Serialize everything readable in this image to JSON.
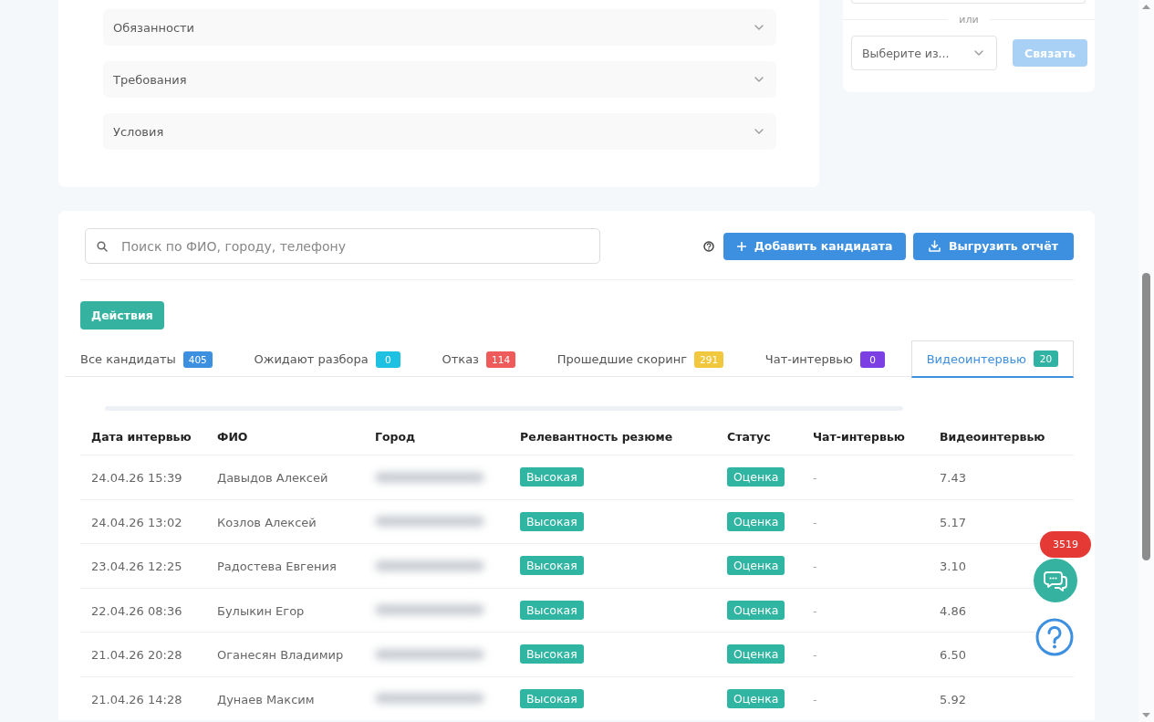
{
  "vacancy_sections": [
    {
      "label": "Обязанности",
      "expanded": false
    },
    {
      "label": "Требования",
      "expanded": false
    },
    {
      "label": "Условия",
      "expanded": false
    }
  ],
  "link_panel": {
    "divider_text": "или",
    "select": {
      "placeholder": "Выберите из..."
    },
    "button": {
      "label": "Связать",
      "disabled": true
    }
  },
  "search": {
    "placeholder": "Поиск по ФИО, городу, телефону"
  },
  "toolbar_buttons": [
    {
      "kind": "add",
      "label": "Добавить кандидата"
    },
    {
      "kind": "download",
      "label": "Выгрузить отчёт"
    }
  ],
  "actions_button": {
    "label": "Действия"
  },
  "tabs": [
    {
      "label": "Все кандидаты",
      "count": "405",
      "color": "#3d8fe0",
      "selected": false
    },
    {
      "label": "Ожидают разбора",
      "count": "0",
      "color": "#1fc1e3",
      "selected": false
    },
    {
      "label": "Отказ",
      "count": "114",
      "color": "#ef5b5b",
      "selected": false
    },
    {
      "label": "Прошедшие скоринг",
      "count": "291",
      "color": "#f1c73e",
      "selected": false
    },
    {
      "label": "Чат-интервью",
      "count": "0",
      "color": "#7b3fe4",
      "selected": false
    },
    {
      "label": "Видеоинтервью",
      "count": "20",
      "color": "#30b3a3",
      "selected": true
    }
  ],
  "table": {
    "columns": [
      "Дата интервью",
      "ФИО",
      "Город",
      "Релевантность резюме",
      "Статус",
      "Чат-интервью",
      "Видеоинтервью"
    ],
    "rows": [
      {
        "date": "24.04.26 15:39",
        "name": "Давыдов Алексей",
        "relevance": "Высокая",
        "status": "Оценка",
        "chat_interview": "-",
        "video_interview": "7.43"
      },
      {
        "date": "24.04.26 13:02",
        "name": "Козлов Алексей",
        "relevance": "Высокая",
        "status": "Оценка",
        "chat_interview": "-",
        "video_interview": "5.17"
      },
      {
        "date": "23.04.26 12:25",
        "name": "Радостева Евгения",
        "relevance": "Высокая",
        "status": "Оценка",
        "chat_interview": "-",
        "video_interview": "3.10"
      },
      {
        "date": "22.04.26 08:36",
        "name": "Булыкин Егор",
        "relevance": "Высокая",
        "status": "Оценка",
        "chat_interview": "-",
        "video_interview": "4.86"
      },
      {
        "date": "21.04.26 20:28",
        "name": "Оганесян Владимир",
        "relevance": "Высокая",
        "status": "Оценка",
        "chat_interview": "-",
        "video_interview": "6.50"
      },
      {
        "date": "21.04.26 14:28",
        "name": "Дунаев Максим",
        "relevance": "Высокая",
        "status": "Оценка",
        "chat_interview": "-",
        "video_interview": "5.92"
      }
    ]
  },
  "chat_widget": {
    "badge": "3519"
  }
}
